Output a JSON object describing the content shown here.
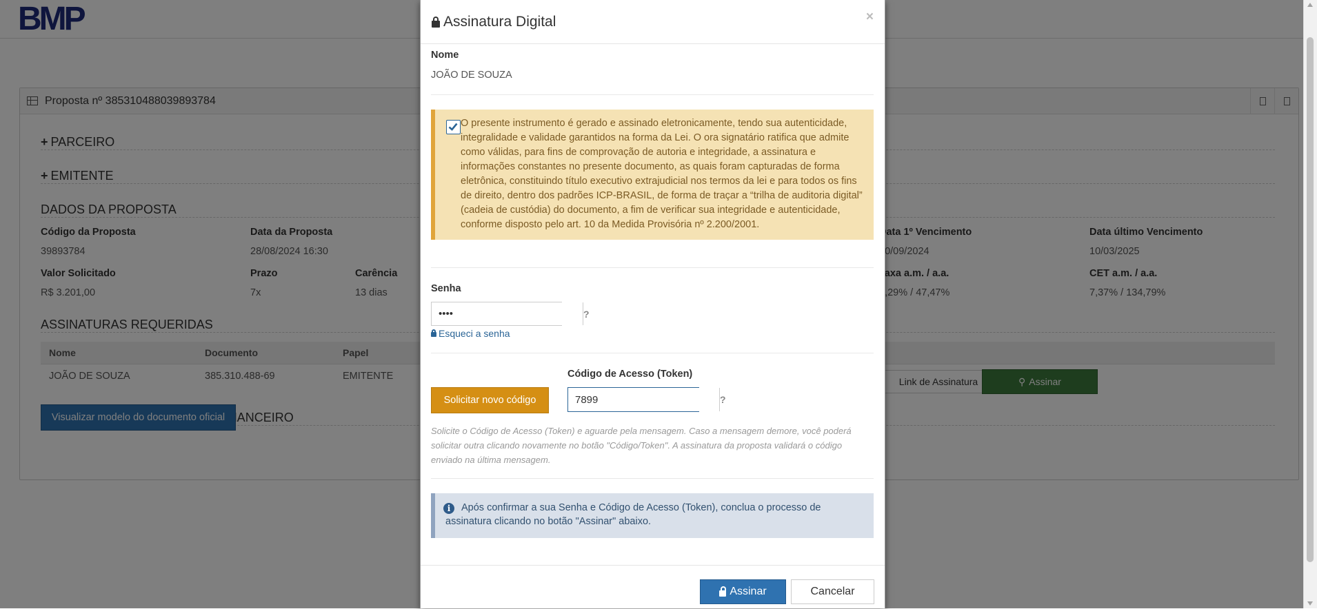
{
  "header": {
    "logo": "BMP"
  },
  "panel": {
    "title": "Proposta nº 385310488039893784",
    "sections": {
      "parceiro": "PARCEIRO",
      "emitente": "EMITENTE",
      "dados": "DADOS DA PROPOSTA",
      "assinaturas": "ASSINATURAS REQUERIDAS",
      "emissao": "EMISSÃO DO INSTRUMENTO FINANCEIRO"
    },
    "fields": [
      {
        "label": "Código da Proposta",
        "value": "39893784"
      },
      {
        "label": "Data da Proposta",
        "value": "28/08/2024 16:30"
      },
      {
        "label": "Data 1º Vencimento",
        "value": "10/09/2024"
      },
      {
        "label": "Data último Vencimento",
        "value": "10/03/2025"
      },
      {
        "label": "Valor Solicitado",
        "value": "R$ 3.201,00"
      },
      {
        "label": "Prazo",
        "value": "7x"
      },
      {
        "label": "Carência",
        "value": "13 dias"
      },
      {
        "label": "Taxa a.m. / a.a.",
        "value": "3,29% / 47,47%"
      },
      {
        "label": "CET a.m. / a.a.",
        "value": "7,37% / 134,79%"
      }
    ],
    "sig_table": {
      "headers": [
        "Nome",
        "Documento",
        "Papel"
      ],
      "row": [
        "JOÃO DE SOUZA",
        "385.310.488-69",
        "EMITENTE"
      ],
      "link_button": "Link de Assinatura",
      "sign_button": "Assinar"
    },
    "doc_button": "Visualizar modelo do documento oficial"
  },
  "modal": {
    "title": "Assinatura Digital",
    "close": "×",
    "nome_label": "Nome",
    "nome_value": "JOÃO DE SOUZA",
    "consent_text": "O presente instrumento é gerado e assinado eletronicamente, tendo sua autenticidade, integralidade e validade garantidos na forma da Lei. O ora signatário ratifica que admite como válidas, para fins de comprovação de autoria e integridade, a assinatura e informações constantes no presente documento, as quais foram capturadas de forma eletrônica, constituindo título executivo extrajudicial nos termos da lei e para todos os fins de direito, dentro dos padrões ICP-BRASIL, de forma de traçar a “trilha de auditoria digital” (cadeia de custódia) do documento, a fim de verificar sua integridade e autenticidade, conforme disposto pelo art. 10 da Medida Provisória nº 2.200/2001.",
    "senha_label": "Senha",
    "senha_value": "1234",
    "help_symbol": "?",
    "forgot_link": "Esqueci a senha",
    "solicitar_button": "Solicitar novo código",
    "token_label": "Código de Acesso (Token)",
    "token_value": "7899",
    "help_text": "Solicite o Código de Acesso (Token) e aguarde pela mensagem. Caso a mensagem demore, você poderá solicitar outra clicando novamente no botão \"Código/Token\". A assinatura da proposta validará o código enviado na última mensagem.",
    "info_icon": "i",
    "info_text": "Após confirmar a sua Senha e Código de Acesso (Token), conclua o processo de assinatura clicando no botão \"Assinar\" abaixo.",
    "assinar_button": "Assinar",
    "cancelar_button": "Cancelar"
  }
}
